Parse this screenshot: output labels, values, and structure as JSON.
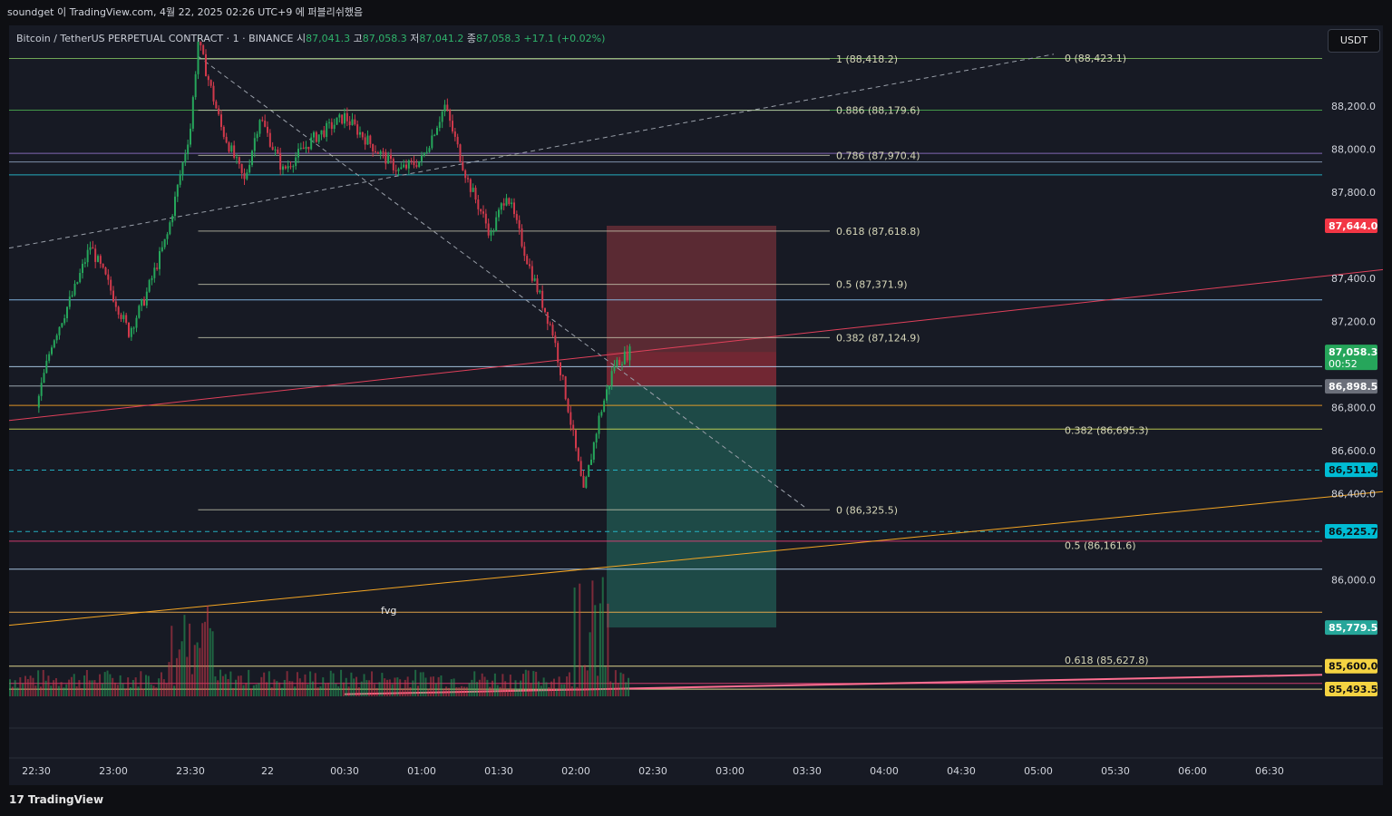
{
  "window": {
    "title": "soundget 이 TradingView.com, 4월 22, 2025 02:26 UTC+9 에 퍼블리쉬했음"
  },
  "symbol": {
    "name": "Bitcoin / TetherUS PERPETUAL CONTRACT · 1 · BINANCE",
    "open_label": "시",
    "open": "87,041.3",
    "high_label": "고",
    "high": "87,058.3",
    "low_label": "저",
    "low": "87,041.2",
    "close_label": "종",
    "close": "87,058.3",
    "change": "+17.1 (+0.02%)"
  },
  "currency_button": "USDT",
  "branding": "TradingView",
  "colors": {
    "background": "#171a24",
    "up": "#26a65b",
    "down": "#d0394b",
    "short_stop_zone": "#5a2a33",
    "short_target_zone": "#1e4a47"
  },
  "chart_data": {
    "type": "candlestick",
    "ylim": [
      85460,
      88540
    ],
    "y_ticks": [
      "88,200.0",
      "88,000.0",
      "87,800.0",
      "87,400.0",
      "87,200.0",
      "86,800.0",
      "86,600.0",
      "86,400.0",
      "86,000.0"
    ],
    "x_ticks": [
      "22:30",
      "23:00",
      "23:30",
      "22",
      "00:30",
      "01:00",
      "01:30",
      "02:00",
      "02:30",
      "03:00",
      "03:30",
      "04:00",
      "04:30",
      "05:00",
      "05:30",
      "06:00",
      "06:30"
    ],
    "price_path": [
      [
        "22:30",
        86800
      ],
      [
        "22:36",
        87100
      ],
      [
        "22:45",
        87350
      ],
      [
        "22:51",
        87550
      ],
      [
        "22:57",
        87400
      ],
      [
        "23:06",
        87150
      ],
      [
        "23:12",
        87300
      ],
      [
        "23:21",
        87600
      ],
      [
        "23:30",
        88100
      ],
      [
        "23:33",
        88500
      ],
      [
        "23:42",
        88100
      ],
      [
        "23:51",
        87850
      ],
      [
        "23:57",
        88150
      ],
      [
        "00:06",
        87900
      ],
      [
        "00:18",
        88050
      ],
      [
        "00:30",
        88150
      ],
      [
        "00:42",
        88000
      ],
      [
        "00:51",
        87900
      ],
      [
        "01:00",
        87950
      ],
      [
        "01:09",
        88200
      ],
      [
        "01:18",
        87850
      ],
      [
        "01:27",
        87600
      ],
      [
        "01:33",
        87800
      ],
      [
        "01:42",
        87450
      ],
      [
        "01:51",
        87150
      ],
      [
        "01:57",
        86800
      ],
      [
        "02:03",
        86400
      ],
      [
        "02:09",
        86750
      ],
      [
        "02:15",
        87000
      ],
      [
        "02:21",
        87058
      ]
    ],
    "volume_note": "volume histogram with spikes near 23:30 and 02:05",
    "fib_levels": [
      {
        "label": "1 (88,418.2)",
        "price": 88418.2
      },
      {
        "label": "0.886 (88,179.6)",
        "price": 88179.6
      },
      {
        "label": "0.786 (87,970.4)",
        "price": 87970.4
      },
      {
        "label": "0.618 (87,618.8)",
        "price": 87618.8
      },
      {
        "label": "0.5 (87,371.9)",
        "price": 87371.9
      },
      {
        "label": "0.382 (87,124.9)",
        "price": 87124.9
      },
      {
        "label": "0 (86,325.5)",
        "price": 86325.5
      }
    ],
    "fib_levels_2": [
      {
        "label": "0 (88,423.1)",
        "price": 88423.1
      },
      {
        "label": "0.382 (86,695.3)",
        "price": 86695.3
      },
      {
        "label": "0.5 (86,161.6)",
        "price": 86161.6
      },
      {
        "label": "0.618 (85,627.8)",
        "price": 85627.8
      }
    ],
    "price_tags": [
      {
        "text": "87,644.0",
        "price": 87644.0,
        "color": "#f23645",
        "text_color": "#ffffff"
      },
      {
        "text": "87,058.3",
        "subtext": "00:52",
        "price": 87058.3,
        "color": "#26a65b",
        "text_color": "#ffffff"
      },
      {
        "text": "86,898.5",
        "price": 86898.5,
        "color": "#6b6f7a",
        "text_color": "#ffffff"
      },
      {
        "text": "86,511.4",
        "price": 86511.4,
        "color": "#00bcd4",
        "text_color": "#0e0f13"
      },
      {
        "text": "86,225.7",
        "price": 86225.7,
        "color": "#00bcd4",
        "text_color": "#0e0f13"
      },
      {
        "text": "85,779.5",
        "price": 85779.5,
        "color": "#26a69a",
        "text_color": "#ffffff"
      },
      {
        "text": "85,600.0",
        "price": 85600.0,
        "color": "#f5d342",
        "text_color": "#0e0f13"
      },
      {
        "text": "85,493.5",
        "price": 85493.5,
        "color": "#f5d342",
        "text_color": "#0e0f13"
      }
    ],
    "horizontal_lines": [
      {
        "price": 88420,
        "color": "#7fbf5f"
      },
      {
        "price": 88180,
        "color": "#4caf50"
      },
      {
        "price": 87980,
        "color": "#9575cd"
      },
      {
        "price": 87940,
        "color": "#8fa3c0"
      },
      {
        "price": 87880,
        "color": "#26c6da"
      },
      {
        "price": 87300,
        "color": "#90caf9"
      },
      {
        "price": 86990,
        "color": "#bbdefb"
      },
      {
        "price": 86900,
        "color": "#b0bec5"
      },
      {
        "price": 86810,
        "color": "#ffa726"
      },
      {
        "price": 86700,
        "color": "#d4e157"
      },
      {
        "price": 86510,
        "color": "#26c6da",
        "dashed": true
      },
      {
        "price": 86225,
        "color": "#26c6da",
        "dashed": true
      },
      {
        "price": 86180,
        "color": "#ec407a"
      },
      {
        "price": 86050,
        "color": "#bbdefb"
      },
      {
        "price": 85850,
        "color": "#ffb74d"
      },
      {
        "price": 85600,
        "color": "#fff59d"
      },
      {
        "price": 85520,
        "color": "#ec407a"
      },
      {
        "price": 85493,
        "color": "#fff59d"
      }
    ],
    "annotations": [
      {
        "text": "fvg",
        "time": "01:00",
        "price": 85860
      }
    ],
    "short_position": {
      "entry": 86898.5,
      "stop": 87644.0,
      "target": 85779.5,
      "start": "02:12",
      "end": "03:18"
    }
  }
}
